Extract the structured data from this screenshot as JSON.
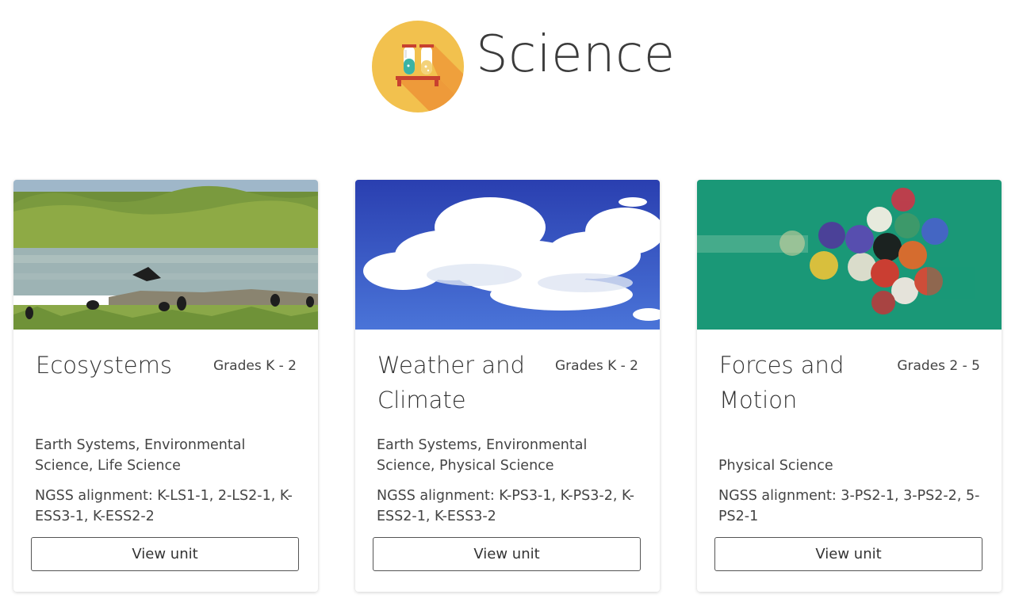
{
  "header": {
    "title": "Science",
    "logo_icon": "test-tubes-icon"
  },
  "cards": [
    {
      "title": "Ecosystems",
      "grade": "Grades K - 2",
      "subjects": "Earth Systems, Environmental Science, Life Science",
      "ngss": "NGSS alignment: K-LS1-1, 2-LS2-1, K-ESS3-1, K-ESS2-2",
      "button_label": "View unit",
      "image": "wetland-birds-photo"
    },
    {
      "title": "Weather and Climate",
      "grade": "Grades K - 2",
      "subjects": "Earth Systems, Environmental Science, Physical Science",
      "ngss": "NGSS alignment: K-PS3-1, K-PS3-2, K-ESS2-1, K-ESS3-2",
      "button_label": "View unit",
      "image": "clouds-sky-photo"
    },
    {
      "title": "Forces and Motion",
      "grade": "Grades 2 - 5",
      "subjects": "Physical Science",
      "ngss": "NGSS alignment: 3-PS2-1, 3-PS2-2, 5-PS2-1",
      "button_label": "View unit",
      "image": "billiard-balls-photo"
    }
  ],
  "colors": {
    "logo_circle": "#f2c14e",
    "logo_shadow": "#ee9a3a",
    "tube_teal": "#3bb3a4",
    "rack_red": "#c8412f",
    "button_border": "#555555"
  }
}
